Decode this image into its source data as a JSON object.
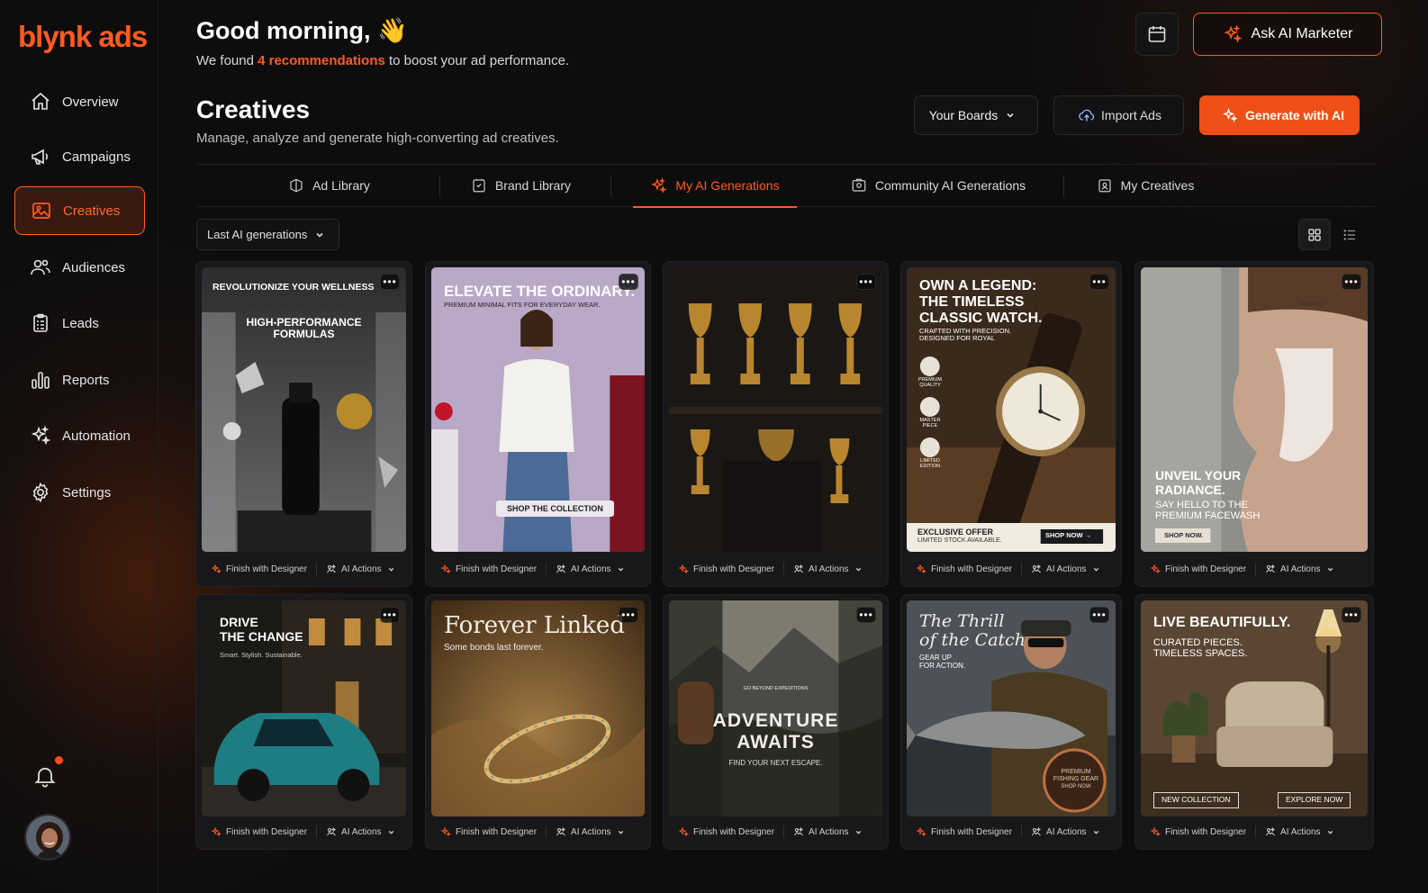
{
  "brand": {
    "logo_text": "blynk ads",
    "accent": "#ff5a1f"
  },
  "sidebar": {
    "items": [
      {
        "label": "Overview",
        "icon": "home-icon"
      },
      {
        "label": "Campaigns",
        "icon": "megaphone-icon"
      },
      {
        "label": "Creatives",
        "icon": "image-icon",
        "active": true
      },
      {
        "label": "Audiences",
        "icon": "users-icon"
      },
      {
        "label": "Leads",
        "icon": "clipboard-icon"
      },
      {
        "label": "Reports",
        "icon": "bar-chart-icon"
      },
      {
        "label": "Automation",
        "icon": "sparkles-icon"
      },
      {
        "label": "Settings",
        "icon": "gear-icon"
      }
    ],
    "notification_icon": "bell-icon",
    "avatar_icon": "user-avatar"
  },
  "header": {
    "greeting": "Good morning, 👋",
    "subtitle_prefix": "We found ",
    "subtitle_highlight": "4 recommendations",
    "subtitle_suffix": " to boost your ad performance.",
    "ask_ai_label": "Ask AI Marketer"
  },
  "page": {
    "title": "Creatives",
    "description": "Manage, analyze and generate high-converting ad creatives.",
    "boards_label": "Your Boards",
    "import_label": "Import Ads",
    "generate_label": "Generate with AI"
  },
  "tabs": [
    {
      "label": "Ad Library"
    },
    {
      "label": "Brand Library"
    },
    {
      "label": "My AI Generations",
      "active": true
    },
    {
      "label": "Community AI Generations"
    },
    {
      "label": "My Creatives"
    }
  ],
  "filter": {
    "label": "Last AI generations"
  },
  "view_toggle": {
    "active": "grid"
  },
  "card_actions": {
    "finish": "Finish with Designer",
    "ai": "AI Actions",
    "more": "•••"
  },
  "cards": [
    {
      "texts": [
        "REVOLUTIONIZE YOUR WELLNESS",
        "HIGH-PERFORMANCE",
        "FORMULAS"
      ]
    },
    {
      "texts": [
        "ELEVATE THE ORDINARY.",
        "PREMIUM MINIMAL FITS FOR EVERYDAY WEAR.",
        "SHOP THE COLLECTION"
      ]
    },
    {
      "texts": []
    },
    {
      "texts": [
        "OWN A LEGEND:",
        "THE TIMELESS",
        "CLASSIC WATCH.",
        "CRAFTED WITH PRECISION.",
        "DESIGNED FOR ROYAL",
        "PREMIUM QUALITY",
        "MASTER PIECE",
        "LIMITED EDITION",
        "EXCLUSIVE OFFER",
        "LIMITED STOCK AVAILABLE.",
        "SHOP NOW →"
      ]
    },
    {
      "texts": [
        "RADIANT",
        "UNVEIL YOUR",
        "RADIANCE.",
        "SAY HELLO TO THE",
        "PREMIUM FACEWASH",
        "SHOP NOW."
      ]
    },
    {
      "texts": [
        "DRIVE",
        "THE CHANGE",
        "Smart. Stylish. Sustainable."
      ]
    },
    {
      "texts": [
        "Forever Linked",
        "Some bonds last forever."
      ]
    },
    {
      "texts": [
        "GO BEYOND EXPEDITIONS",
        "ADVENTURE",
        "AWAITS",
        "FIND YOUR NEXT ESCAPE."
      ]
    },
    {
      "texts": [
        "The Thrill",
        "of the Catch",
        "GEAR UP",
        "FOR ACTION.",
        "PREMIUM",
        "FISHING GEAR",
        "SHOP NOW"
      ]
    },
    {
      "texts": [
        "LIVE BEAUTIFULLY.",
        "CURATED PIECES.",
        "TIMELESS SPACES.",
        "NEW COLLECTION",
        "EXPLORE NOW"
      ]
    }
  ]
}
